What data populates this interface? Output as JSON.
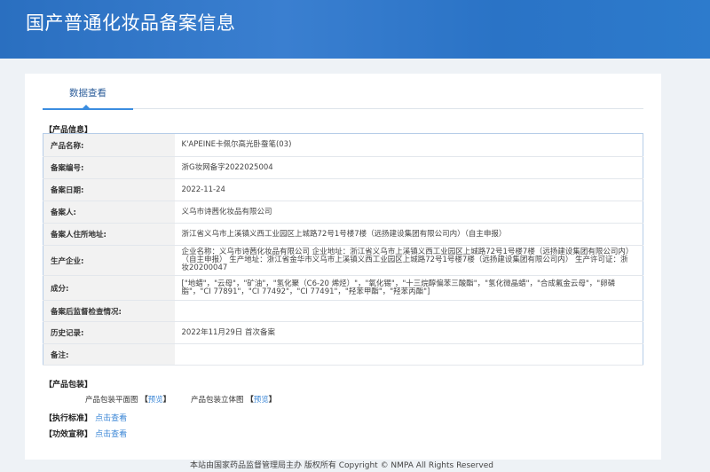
{
  "header": {
    "title": "国产普通化妆品备案信息"
  },
  "tab": {
    "label": "数据查看"
  },
  "section_product_info": "【产品信息】",
  "rows": [
    {
      "label": "产品名称:",
      "value": "K'APEINE卡佩尔高光卧蚕笔(03)"
    },
    {
      "label": "备案编号:",
      "value": "浙G妆网备字2022025004"
    },
    {
      "label": "备案日期:",
      "value": "2022-11-24"
    },
    {
      "label": "备案人:",
      "value": "义乌市诗茜化妆品有限公司"
    },
    {
      "label": "备案人住所地址:",
      "value": "浙江省义乌市上溪镇义西工业园区上城路72号1号楼7楼（远扬建设集团有限公司内）（自主申报）"
    },
    {
      "label": "生产企业:",
      "value": "企业名称：义乌市诗茜化妆品有限公司 企业地址：浙江省义乌市上溪镇义西工业园区上城路72号1号楼7楼（远扬建设集团有限公司内）（自主申报） 生产地址：浙江省金华市义乌市上溪镇义西工业园区上城路72号1号楼7楼（远扬建设集团有限公司内） 生产许可证：浙妆20200047"
    },
    {
      "label": "成分:",
      "value": "[\"地蜡\"，\"云母\"，\"矿油\"，\"氢化聚（C6-20 烯烃）\"，\"氧化锡\"，\"十三烷醇偏苯三酸酯\"，\"氢化微晶蜡\"，\"合成氟金云母\"，\"卵磷脂\"，\"CI 77891\"，\"CI 77492\"，\"CI 77491\"，\"羟苯甲酯\"，\"羟苯丙酯\"]"
    },
    {
      "label": "备案后监督检查情况:",
      "value": ""
    },
    {
      "label": "历史记录:",
      "value": "2022年11月29日 首次备案"
    },
    {
      "label": "备注:",
      "value": ""
    }
  ],
  "packaging": {
    "title": "【产品包装】",
    "flat_label": "产品包装平面图",
    "solid_label": "产品包装立体图",
    "bracket_open": "【",
    "bracket_close": "】",
    "preview": "预览"
  },
  "standard": {
    "title": "【执行标准】",
    "link": "点击查看"
  },
  "efficacy": {
    "title": "【功效宣称】",
    "link": "点击查看"
  },
  "footer": {
    "text": "本站由国家药品监督管理局主办 版权所有 Copyright © NMPA All Rights Reserved"
  }
}
